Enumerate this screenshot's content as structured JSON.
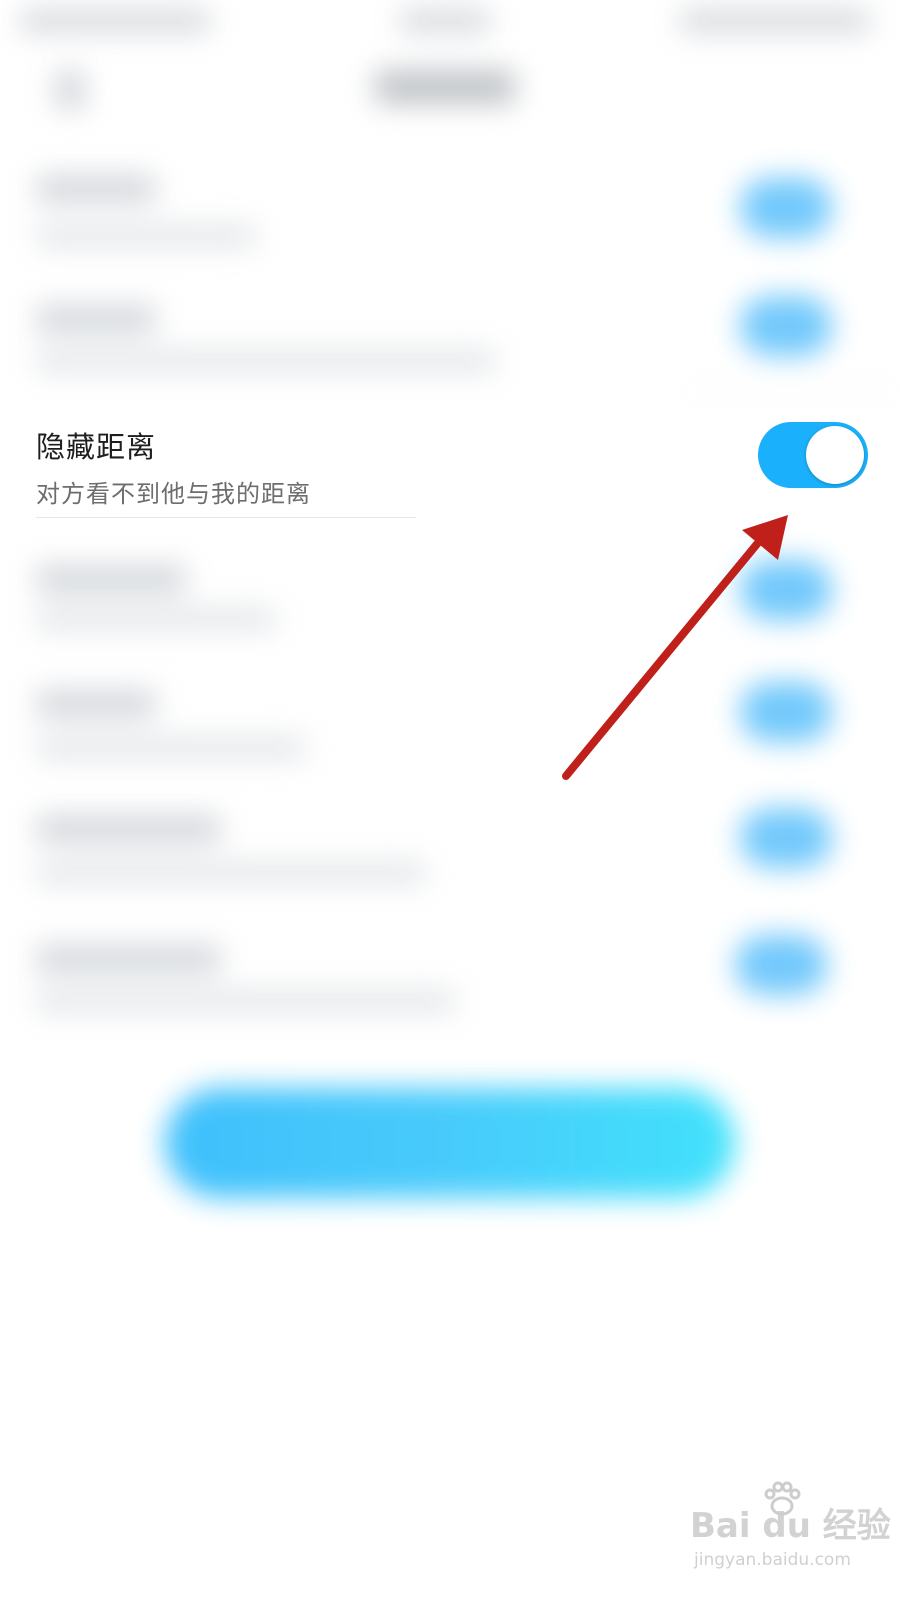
{
  "setting": {
    "title": "隐藏距离",
    "subtitle": "对方看不到他与我的距离",
    "enabled": true
  },
  "colors": {
    "toggle_on": "#1ab0fb",
    "arrow": "#c0201a",
    "button_gradient_start": "#2bb9fb",
    "button_gradient_end": "#2ddffb"
  },
  "watermark": {
    "logo": "Bai du 经验",
    "url": "jingyan.baidu.com"
  }
}
